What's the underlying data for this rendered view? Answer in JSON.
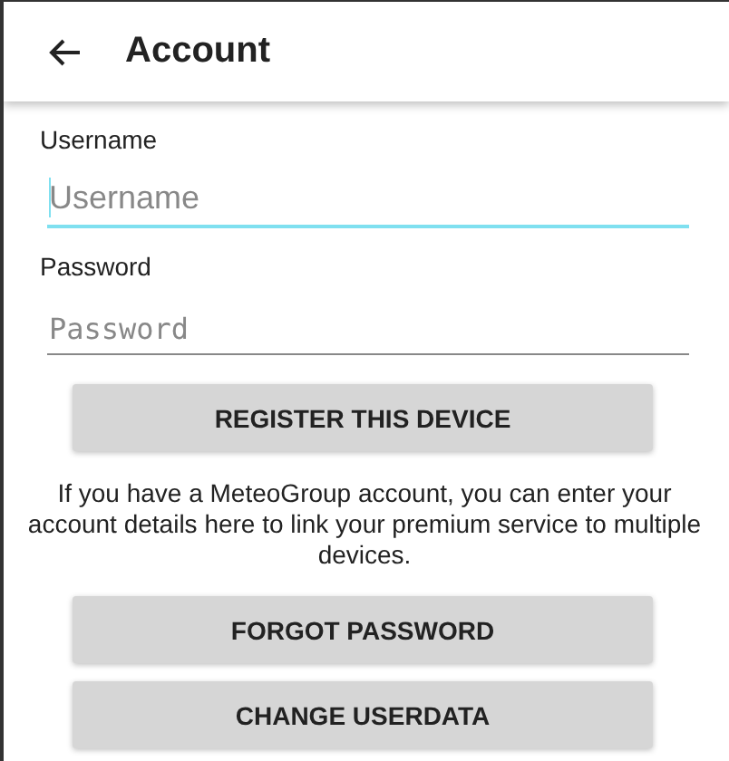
{
  "app_bar": {
    "title": "Account"
  },
  "fields": [
    {
      "label": "Username",
      "placeholder": "Username",
      "kind": "text",
      "focused": true
    },
    {
      "label": "Password",
      "placeholder": "Password",
      "kind": "password",
      "focused": false
    }
  ],
  "register_button": "REGISTER THIS DEVICE",
  "info_text": "If you have a MeteoGroup account, you can enter your account details here to link your premium service to multiple devices.",
  "buttons": [
    "FORGOT PASSWORD",
    "CHANGE USERDATA"
  ]
}
